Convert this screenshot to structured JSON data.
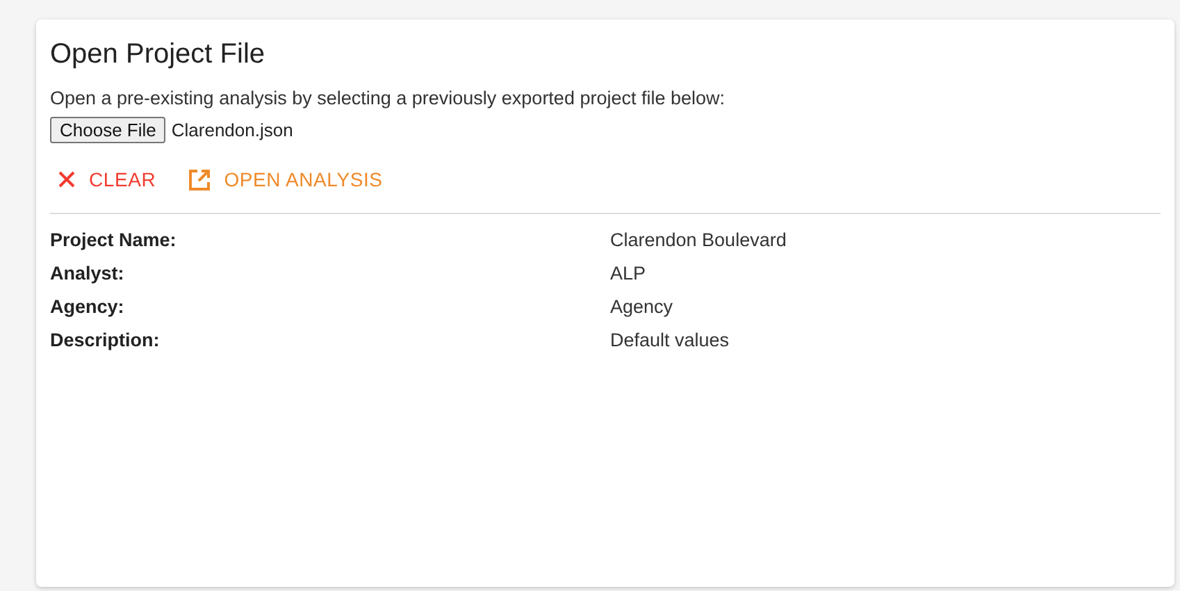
{
  "card": {
    "title": "Open Project File",
    "description": "Open a pre-existing analysis by selecting a previously exported project file below:"
  },
  "file_input": {
    "button": "Choose File",
    "filename": "Clarendon.json"
  },
  "actions": [
    {
      "kind": "clear",
      "label": "CLEAR"
    },
    {
      "kind": "open",
      "label": "OPEN ANALYSIS"
    }
  ],
  "details": [
    {
      "label": "Project Name:",
      "value": "Clarendon Boulevard"
    },
    {
      "label": "Analyst:",
      "value": "ALP"
    },
    {
      "label": "Agency:",
      "value": "Agency"
    },
    {
      "label": "Description:",
      "value": "Default values"
    }
  ]
}
